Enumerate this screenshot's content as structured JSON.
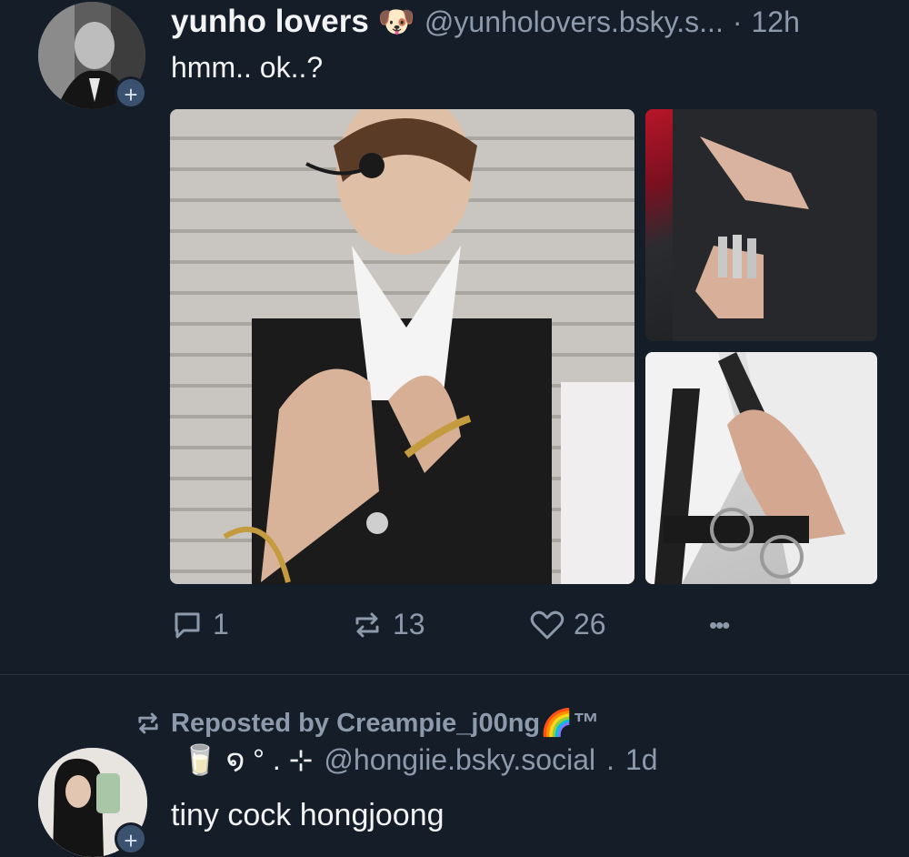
{
  "post1": {
    "author_name": "yunho lovers",
    "author_emoji": "🐶",
    "handle": "@yunholovers.bsky.s...",
    "separator": "·",
    "time": "12h",
    "text": "hmm.. ok..?",
    "avatar_plus": "+",
    "images": [
      "photo-main",
      "photo-top-right",
      "photo-bottom-right"
    ],
    "actions": {
      "reply_count": "1",
      "repost_count": "13",
      "like_count": "26",
      "more_label": "•••"
    }
  },
  "post2": {
    "repost_label": "Reposted by Creampie_j00ng🌈™",
    "author_prefix": "🥛 ໑ ° . ⊹",
    "handle": "@hongiie.bsky.social",
    "separator": ".",
    "time": "1d",
    "text": "tiny cock hongjoong",
    "avatar_plus": "+"
  },
  "colors": {
    "background": "#151d28",
    "muted_text": "#8d9aab",
    "primary_text": "#f1f3f5",
    "divider": "#2b3645"
  }
}
